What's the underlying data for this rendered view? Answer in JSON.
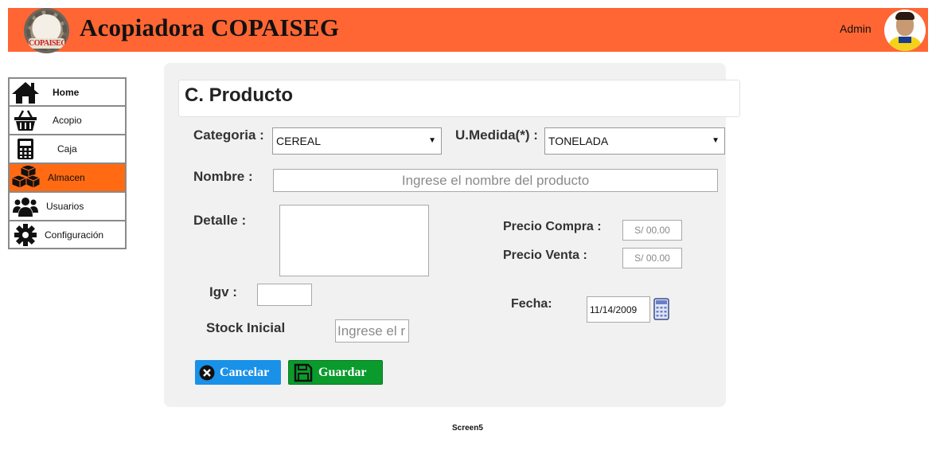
{
  "header": {
    "title": "Acopiadora COPAISEG",
    "logo_text": "COPAISEG",
    "user": "Admin",
    "colors": {
      "bar": "#ff6633",
      "active_nav": "#ff6a13"
    }
  },
  "sidebar": {
    "items": [
      {
        "label": "Home",
        "icon": "home-icon"
      },
      {
        "label": "Acopio",
        "icon": "basket-icon"
      },
      {
        "label": "Caja",
        "icon": "calculator-icon"
      },
      {
        "label": "Almacen",
        "icon": "boxes-icon",
        "active": true
      },
      {
        "label": "Usuarios",
        "icon": "users-icon"
      },
      {
        "label": "Configuración",
        "icon": "gear-icon"
      }
    ]
  },
  "form": {
    "title": "C. Producto",
    "categoria_label": "Categoria  :",
    "categoria_value": "CEREAL",
    "medida_label": "U.Medida(*) :",
    "medida_value": "TONELADA",
    "nombre_label": "Nombre :",
    "nombre_placeholder": "Ingrese el nombre del producto",
    "detalle_label": "Detalle :",
    "precio_compra_label": "Precio Compra :",
    "precio_compra_placeholder": "S/ 00.00",
    "precio_venta_label": "Precio Venta :",
    "precio_venta_placeholder": "S/ 00.00",
    "igv_label": "Igv :",
    "fecha_label": "Fecha:",
    "fecha_value": "11/14/2009",
    "stock_label": "Stock Inicial",
    "stock_placeholder": "Ingrese el r",
    "cancel_label": "Cancelar",
    "save_label": "Guardar"
  },
  "footer": {
    "screen": "Screen5"
  }
}
